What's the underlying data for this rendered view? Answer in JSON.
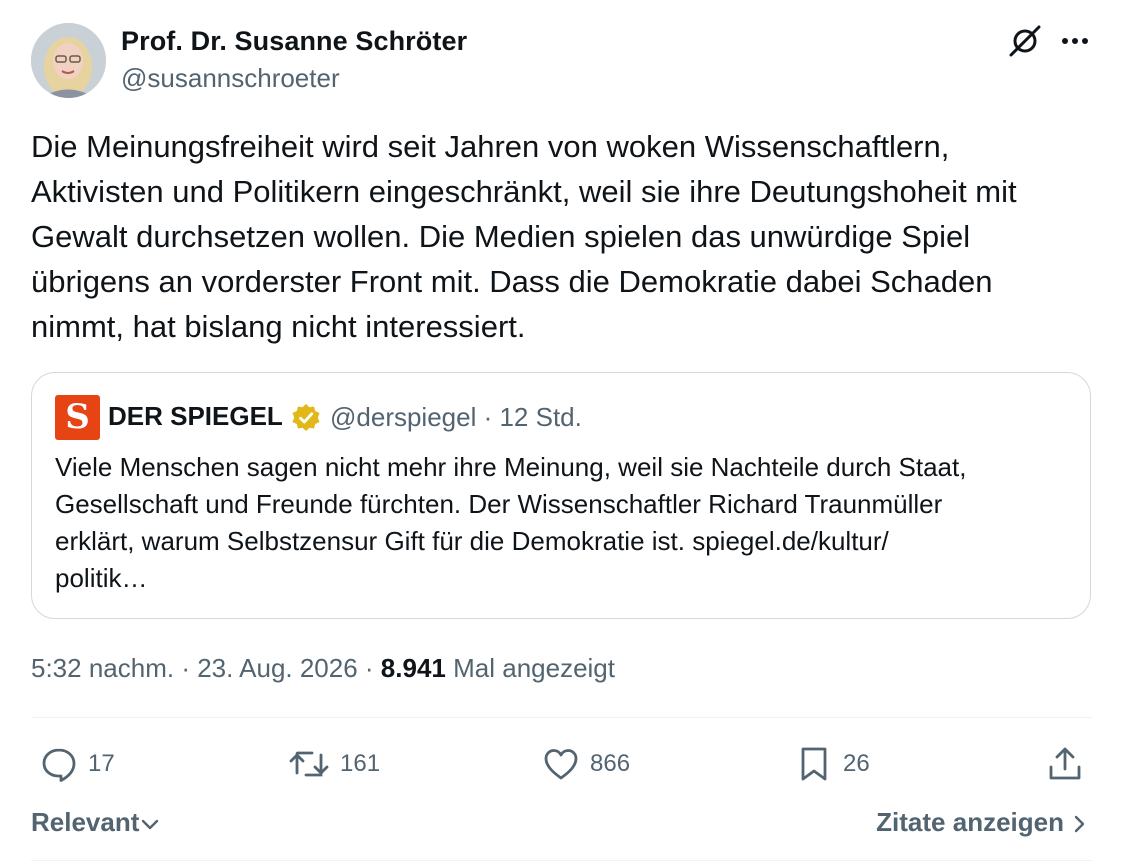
{
  "author": {
    "display_name": "Prof. Dr. Susanne Schröter",
    "handle": "@susannschroeter"
  },
  "tweet": {
    "text": "Die Meinungsfreiheit wird seit Jahren von woken Wissenschaftlern,\nAktivisten und Politikern eingeschränkt, weil sie ihre Deutungshoheit mit\nGewalt durchsetzen wollen.  Die Medien spielen das unwürdige Spiel\nübrigens an vorderster Front mit. Dass die Demokratie dabei Schaden\nnimmt, hat bislang nicht interessiert."
  },
  "quote": {
    "logo_letter": "S",
    "name": "DER SPIEGEL",
    "handle_time": "@derspiegel · 12 Std.",
    "text": "Viele Menschen sagen nicht mehr ihre Meinung, weil sie Nachteile durch Staat,\nGesellschaft und Freunde fürchten. Der Wissenschaftler Richard Traunmüller\nerklärt, warum Selbstzensur Gift für die Demokratie ist. spiegel.de/kultur/\npolitik…"
  },
  "meta": {
    "time": "5:32 nachm.",
    "date": "23. Aug. 2026",
    "separator": " · ",
    "views_count": "8.941",
    "views_label": "Mal angezeigt"
  },
  "actions": {
    "replies": "17",
    "reposts": "161",
    "likes": "866",
    "bookmarks": "26"
  },
  "footer": {
    "sort_label": "Relevant",
    "quotes_label": "Zitate anzeigen"
  },
  "icons": {
    "grok": "grok-icon",
    "more": "more-icon",
    "verified": "verified-badge-icon",
    "reply": "reply-icon",
    "repost": "repost-icon",
    "like": "like-icon",
    "bookmark": "bookmark-icon",
    "share": "share-icon"
  },
  "colors": {
    "text": "#0f1419",
    "secondary": "#536471",
    "border": "#cfd9de",
    "verified_gold": "#e2b719",
    "spiegel_orange": "#e64415"
  }
}
